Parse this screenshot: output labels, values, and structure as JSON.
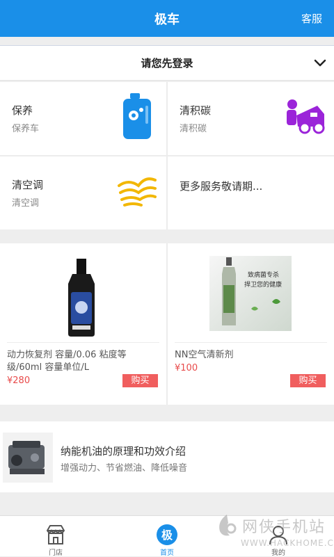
{
  "header": {
    "title": "极车",
    "service_label": "客服"
  },
  "login": {
    "text": "请您先登录",
    "icon": "chevron-down-icon"
  },
  "services": [
    {
      "name": "保养",
      "sub": "保养车",
      "icon": "oil-can-icon",
      "color": "#1a8fe8"
    },
    {
      "name": "清积碳",
      "sub": "清积碳",
      "icon": "car-repair-icon",
      "color": "#9b24d9"
    },
    {
      "name": "清空调",
      "sub": "清空调",
      "icon": "air-conditioner-icon",
      "color": "#f2b705"
    },
    {
      "name": "更多服务敬请期...",
      "sub": "",
      "icon": "",
      "color": ""
    }
  ],
  "products": [
    {
      "name": "动力恢复剂 容量/0.06 粘度等级/60ml 容量单位/L",
      "price": "¥280",
      "buy_label": "购买",
      "image": "engine-additive-bottle-image"
    },
    {
      "name": "NN空气清新剂",
      "price": "¥100",
      "buy_label": "购买",
      "image": "air-freshener-spray-image",
      "image_caption_1": "致病菌专杀",
      "image_caption_2": "捍卫您的健康"
    }
  ],
  "article": {
    "title": "纳能机油的原理和功效介绍",
    "desc": "增强动力、节省燃油、降低噪音",
    "image": "engine-image"
  },
  "tabs": [
    {
      "label": "门店",
      "icon": "store-icon",
      "active": false
    },
    {
      "label": "首页",
      "icon": "home-ji-icon",
      "badge": "极",
      "active": true
    },
    {
      "label": "我的",
      "icon": "profile-icon",
      "active": false
    }
  ],
  "watermark": {
    "text": "网侠手机站",
    "url": "WWW.HACKHOME.COM"
  },
  "colors": {
    "primary": "#1a8fe8",
    "price": "#e84a4a",
    "buy_button": "#f05e5e"
  }
}
